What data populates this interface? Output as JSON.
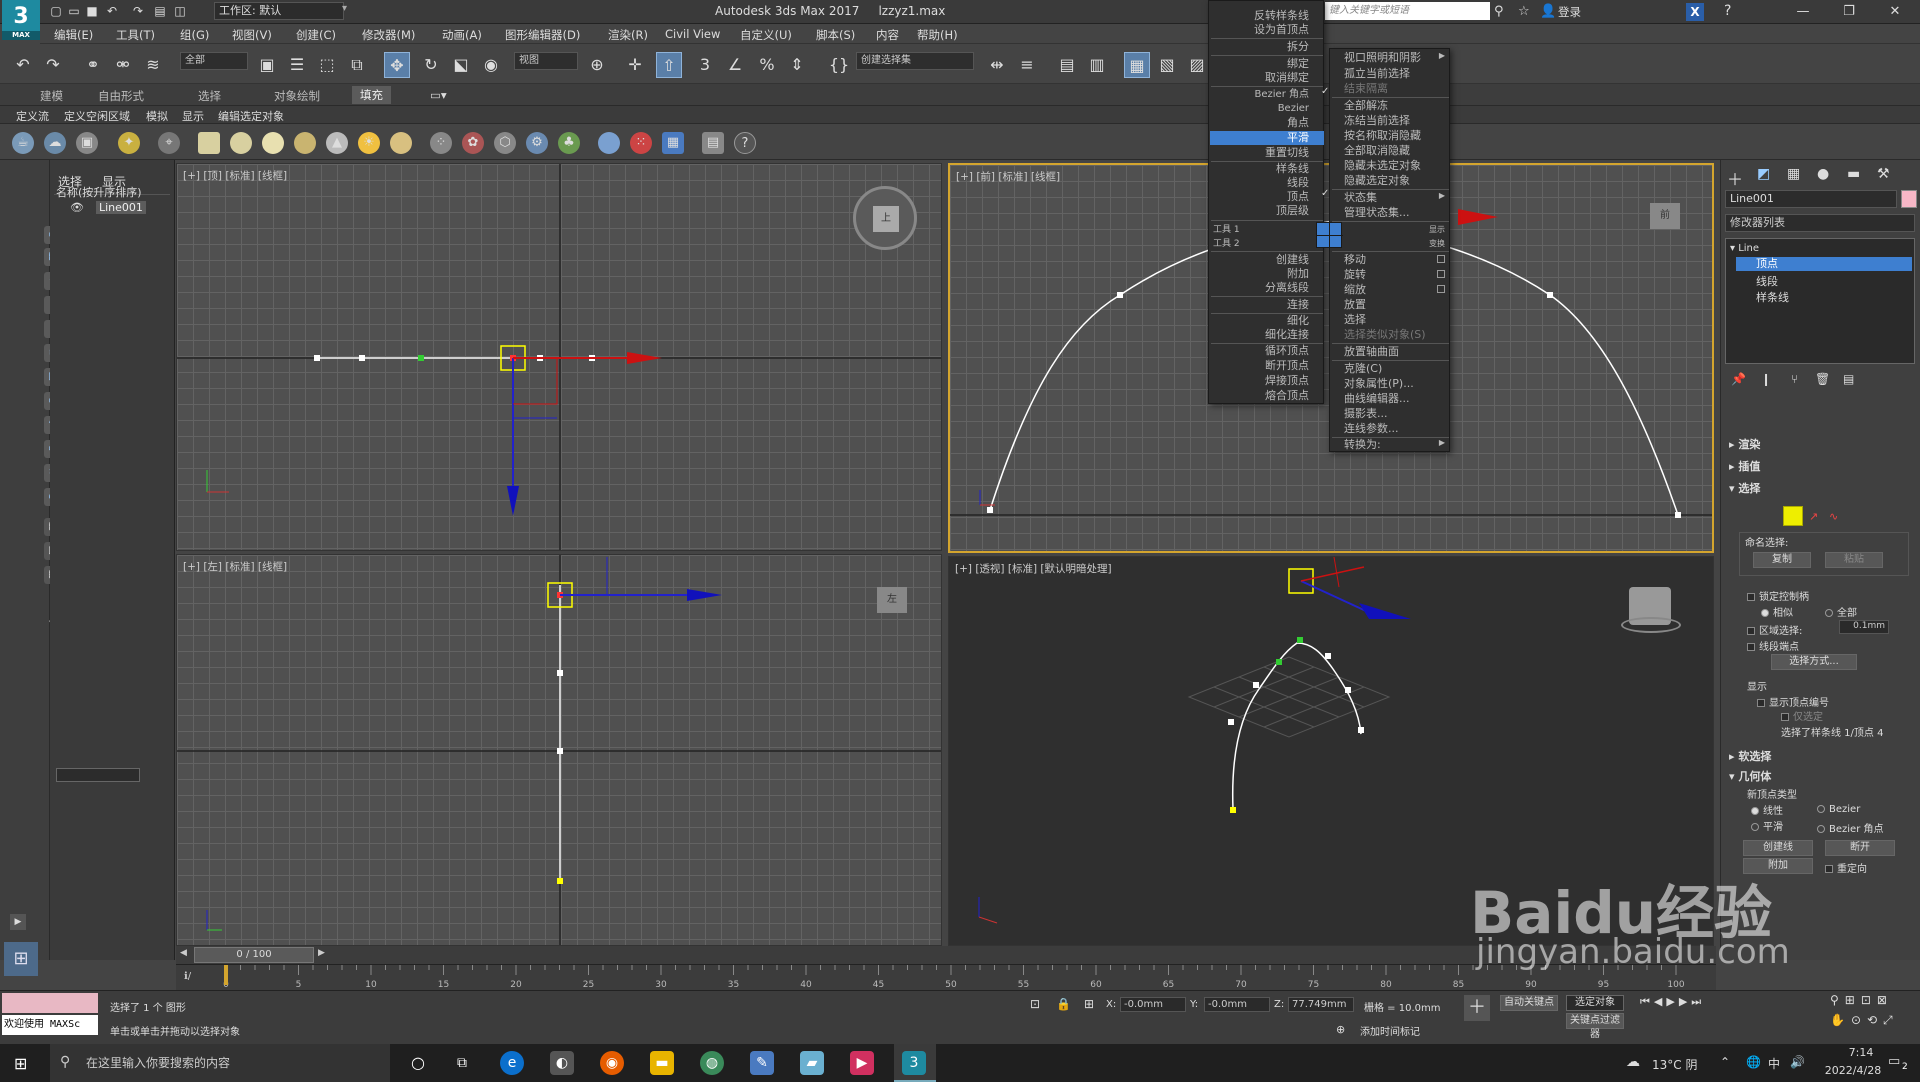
{
  "app": {
    "title": "Autodesk 3ds Max 2017",
    "file": "lzzyz1.max",
    "logo_text": "3",
    "logo_sub": "MAX",
    "workspace": "工作区: 默认",
    "search_placeholder": "键入关键字或短语",
    "login": "登录"
  },
  "menubar": [
    "编辑(E)",
    "工具(T)",
    "组(G)",
    "视图(V)",
    "创建(C)",
    "修改器(M)",
    "动画(A)",
    "图形编辑器(D)",
    "渲染(R)",
    "Civil View",
    "自定义(U)",
    "脚本(S)",
    "内容",
    "帮助(H)"
  ],
  "toolbar": {
    "filter": "全部",
    "coord": "视图",
    "selection_set": "创建选择集"
  },
  "ribbon": {
    "tabs": [
      "建模",
      "自由形式",
      "选择",
      "对象绘制",
      "填充"
    ],
    "sub": [
      "定义流",
      "定义空闲区域",
      "模拟",
      "显示",
      "编辑选定对象"
    ]
  },
  "scene_explorer": {
    "tabs": [
      "选择",
      "显示"
    ],
    "header": "名称(按升序排序)",
    "item": "Line001"
  },
  "viewports": {
    "top": "[+] [顶] [标准] [线框]",
    "front": "[+] [前] [标准] [线框]",
    "left": "[+] [左] [标准] [线框]",
    "persp": "[+] [透视] [标准] [默认明暗处理]",
    "cube_top": "上",
    "cube_front": "前",
    "cube_left": "左"
  },
  "quad_left": [
    "反转样条线",
    "设为首顶点",
    "拆分",
    "绑定",
    "取消绑定",
    "Bezier 角点",
    "Bezier",
    "角点",
    "平滑",
    "重置切线",
    "样条线",
    "线段",
    "顶点",
    "顶层级",
    "工具 1",
    "工具 2",
    "创建线",
    "附加",
    "分离线段",
    "连接",
    "细化",
    "细化连接",
    "循环顶点",
    "断开顶点",
    "焊接顶点",
    "熔合顶点"
  ],
  "quad_right": [
    "视口照明和阴影",
    "孤立当前选择",
    "结束隔离",
    "全部解冻",
    "冻结当前选择",
    "按名称取消隐藏",
    "全部取消隐藏",
    "隐藏未选定对象",
    "隐藏选定对象",
    "状态集",
    "管理状态集...",
    "显示",
    "变换",
    "移动",
    "旋转",
    "缩放",
    "放置",
    "选择",
    "选择类似对象(S)",
    "放置轴曲面",
    "克隆(C)",
    "对象属性(P)...",
    "曲线编辑器...",
    "摄影表...",
    "连线参数...",
    "转换为:"
  ],
  "right_panel": {
    "object_name": "Line001",
    "modifier_list": "修改器列表",
    "stack": [
      "Line",
      "顶点",
      "线段",
      "样条线"
    ],
    "rollouts": [
      "渲染",
      "插值",
      "选择",
      "软选择",
      "几何体"
    ],
    "named_sel": "命名选择:",
    "copy": "复制",
    "paste": "粘贴",
    "lock_handles": "锁定控制柄",
    "similar": "相似",
    "all": "全部",
    "area_sel": "区域选择:",
    "area_val": "0.1mm",
    "seg_end": "线段端点",
    "sel_method": "选择方式...",
    "display": "显示",
    "show_vnum": "显示顶点编号",
    "only_sel": "仅选定",
    "status": "选择了样条线 1/顶点 4",
    "new_vtype": "新顶点类型",
    "linear": "线性",
    "bezier": "Bezier",
    "smooth": "平滑",
    "bezier_corner": "Bezier 角点",
    "create_line": "创建线",
    "break": "断开",
    "attach": "附加",
    "reorient": "重定向"
  },
  "timeline": {
    "slider": "0 / 100",
    "ticks": [
      "0",
      "5",
      "10",
      "15",
      "20",
      "25",
      "30",
      "35",
      "40",
      "45",
      "50",
      "55",
      "60",
      "65",
      "70",
      "75",
      "80",
      "85",
      "90",
      "95",
      "100"
    ]
  },
  "status": {
    "maxscript": "欢迎使用 MAXSc",
    "line1": "选择了 1 个 图形",
    "line2": "单击或单击并拖动以选择对象",
    "x_label": "X:",
    "x": "-0.0mm",
    "y_label": "Y:",
    "y": "-0.0mm",
    "z_label": "Z:",
    "z": "77.749mm",
    "grid": "栅格 = 10.0mm",
    "add_time_tag": "添加时间标记",
    "auto_key": "自动关键点",
    "set_key": "选定对象",
    "key_filter": "关键点过滤器"
  },
  "taskbar": {
    "search": "在这里输入你要搜索的内容",
    "temp": "13°C 阴",
    "time": "7:14",
    "date": "2022/4/28",
    "ime": "中",
    "notif": "2"
  },
  "watermark": {
    "brand": "Baidu经验",
    "url": "jingyan.baidu.com"
  },
  "colors": {
    "accent": "#3e7fd0",
    "active_viewport": "#d4a52e",
    "selected_vertex": "#ffff00"
  }
}
